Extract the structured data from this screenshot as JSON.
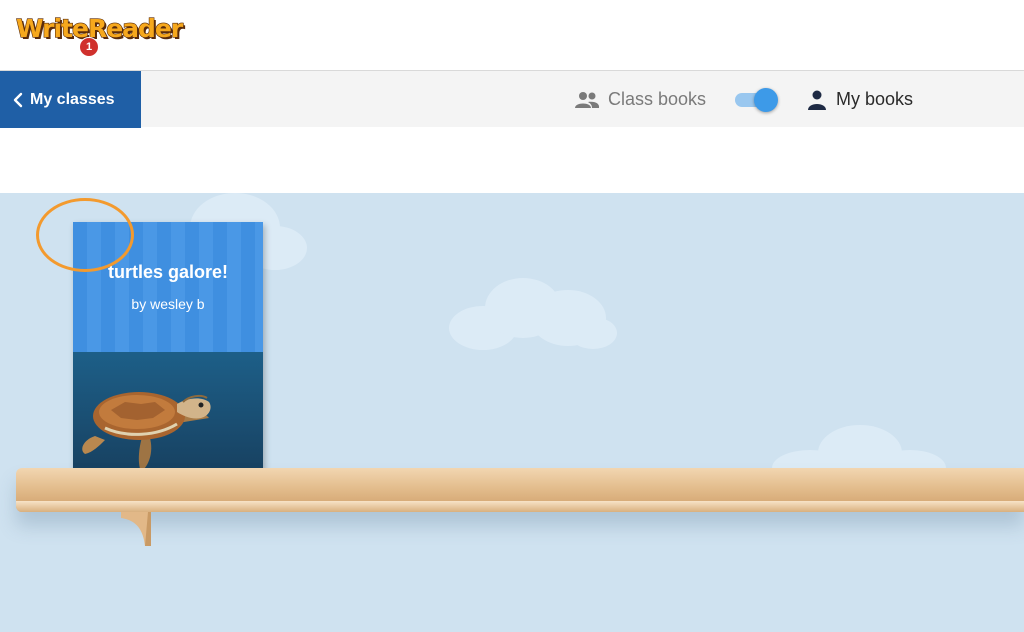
{
  "app": {
    "logo_text": "WriteReader"
  },
  "toolbar": {
    "back_label": "My classes",
    "class_books_label": "Class books",
    "my_books_label": "My books",
    "toggle_on": true
  },
  "colors": {
    "accent_blue": "#1f5fa6",
    "toggle_blue": "#3d9ae8",
    "badge_red": "#d0312d",
    "highlight_orange": "#f39a2e",
    "sky": "#cfe2f0"
  },
  "shelf": {
    "books": [
      {
        "title": "turtles galore!",
        "author": "by wesley b",
        "badge_count": "1"
      }
    ]
  },
  "icons": {
    "back": "chevron-left-icon",
    "class_books": "group-icon",
    "my_books": "person-icon"
  }
}
